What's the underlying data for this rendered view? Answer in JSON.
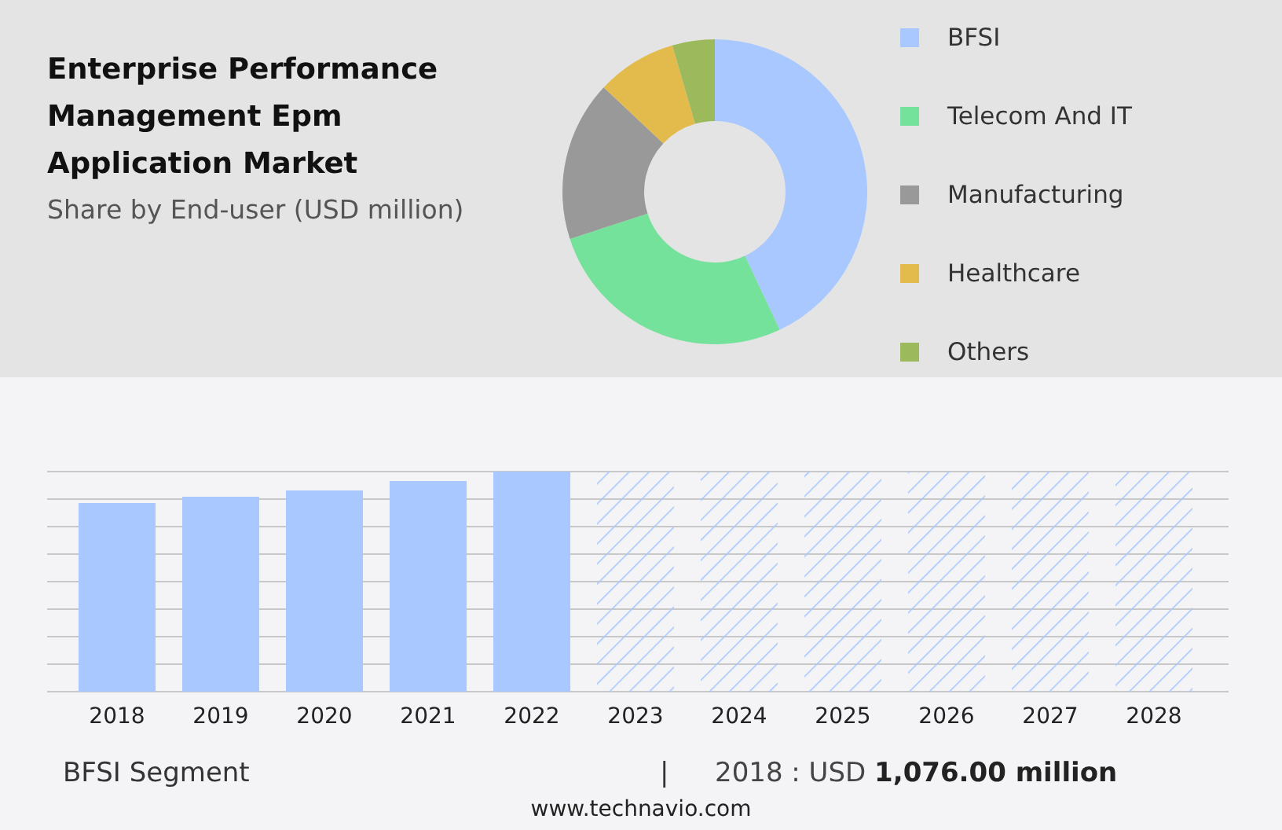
{
  "header": {
    "title": "Enterprise Performance Management Epm Application Market",
    "subtitle": "Share by End-user (USD million)"
  },
  "legend": [
    {
      "label": "BFSI",
      "color": "#a8c8ff"
    },
    {
      "label": "Telecom And IT",
      "color": "#74e29a"
    },
    {
      "label": "Manufacturing",
      "color": "#999999"
    },
    {
      "label": "Healthcare",
      "color": "#e3bb4c"
    },
    {
      "label": "Others",
      "color": "#9cba5c"
    }
  ],
  "bar_chart": {
    "years": [
      {
        "label": "2018",
        "kind": "actual"
      },
      {
        "label": "2019",
        "kind": "actual"
      },
      {
        "label": "2020",
        "kind": "actual"
      },
      {
        "label": "2021",
        "kind": "actual"
      },
      {
        "label": "2022",
        "kind": "actual"
      },
      {
        "label": "2023",
        "kind": "forecast"
      },
      {
        "label": "2024",
        "kind": "forecast"
      },
      {
        "label": "2025",
        "kind": "forecast"
      },
      {
        "label": "2026",
        "kind": "forecast"
      },
      {
        "label": "2027",
        "kind": "forecast"
      },
      {
        "label": "2028",
        "kind": "forecast"
      }
    ]
  },
  "footer": {
    "segment": "BFSI Segment",
    "separator": "|",
    "value": "2018 : USD **1,076.00 million**",
    "source": "www.technavio.com"
  }
}
